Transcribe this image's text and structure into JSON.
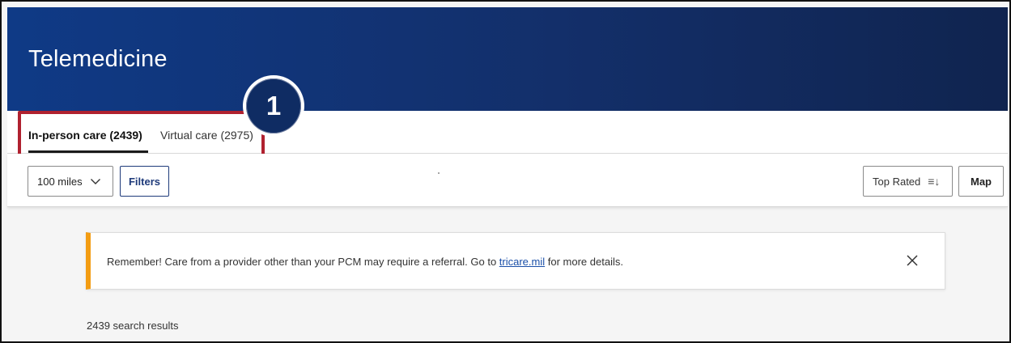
{
  "header": {
    "title": "Telemedicine"
  },
  "tabs": [
    {
      "label": "In-person care (2439)",
      "active": true
    },
    {
      "label": "Virtual care (2975)",
      "active": false
    }
  ],
  "callout": {
    "number": "1"
  },
  "toolbar": {
    "distance_label": "100 miles",
    "filters_label": "Filters",
    "sort_label": "Top Rated",
    "map_label": "Map"
  },
  "notice": {
    "text_before": "Remember! Care from a provider other than your PCM may require a referral. Go to ",
    "link_text": "tricare.mil",
    "text_after": " for more details."
  },
  "results": {
    "count_text": "2439 search results"
  },
  "colors": {
    "header_start": "#0f3a86",
    "header_end": "#10244f",
    "highlight": "#b0212f",
    "notice_accent": "#f39c12",
    "link": "#1a4fa8",
    "filters_button": "#1e3a7a"
  },
  "icons": [
    "chevron-down-icon",
    "sort-descending-icon",
    "close-icon"
  ]
}
